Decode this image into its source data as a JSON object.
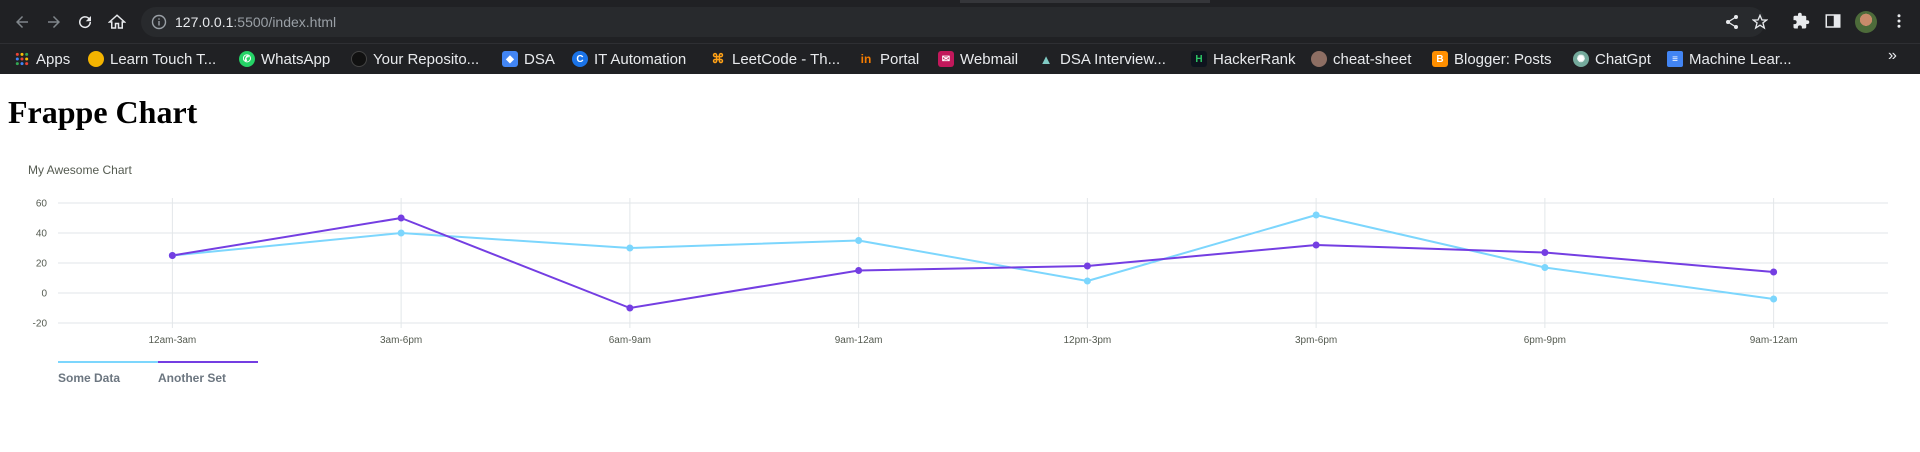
{
  "browser": {
    "url_host": "127.0.0.1",
    "url_rest": ":5500/index.html",
    "bookmarks": [
      {
        "label": "Apps",
        "icon": "apps-grid-icon",
        "color": "#e8eaed"
      },
      {
        "label": "Learn Touch T...",
        "icon": "typing-icon",
        "color": "#f4b400"
      },
      {
        "label": "WhatsApp",
        "icon": "whatsapp-icon",
        "color": "#25d366"
      },
      {
        "label": "Your Reposito...",
        "icon": "github-icon",
        "color": "#111111"
      },
      {
        "label": "DSA",
        "icon": "shield-icon",
        "color": "#4285f4"
      },
      {
        "label": "IT Automation",
        "icon": "coursera-icon",
        "color": "#1a73e8"
      },
      {
        "label": "LeetCode - Th...",
        "icon": "leetcode-icon",
        "color": "#ffa116"
      },
      {
        "label": "Portal",
        "icon": "portal-icon",
        "color": "#f57c00"
      },
      {
        "label": "Webmail",
        "icon": "webmail-icon",
        "color": "#c2185b"
      },
      {
        "label": "DSA Interview...",
        "icon": "mountain-icon",
        "color": "#80cbc4"
      },
      {
        "label": "HackerRank",
        "icon": "hackerrank-icon",
        "color": "#2ec866"
      },
      {
        "label": "cheat-sheet",
        "icon": "cheat-sheet-icon",
        "color": "#8d6e63"
      },
      {
        "label": "Blogger: Posts",
        "icon": "blogger-icon",
        "color": "#ff8f00"
      },
      {
        "label": "ChatGpt",
        "icon": "chatgpt-icon",
        "color": "#74aa9c"
      },
      {
        "label": "Machine Lear...",
        "icon": "docs-icon",
        "color": "#4285f4"
      }
    ]
  },
  "page": {
    "heading": "Frappe Chart"
  },
  "chart_data": {
    "type": "line",
    "title": "My Awesome Chart",
    "categories": [
      "12am-3am",
      "3am-6pm",
      "6am-9am",
      "9am-12am",
      "12pm-3pm",
      "3pm-6pm",
      "6pm-9pm",
      "9am-12am"
    ],
    "yticks": [
      60,
      40,
      20,
      0,
      -20
    ],
    "ylim": [
      -20,
      60
    ],
    "grid": true,
    "legend_position": "bottom-left",
    "series": [
      {
        "name": "Some Data",
        "color": "#7cd6fd",
        "values": [
          25,
          40,
          30,
          35,
          8,
          52,
          17,
          -4
        ]
      },
      {
        "name": "Another Set",
        "color": "#743ee2",
        "values": [
          25,
          50,
          -10,
          15,
          18,
          32,
          27,
          14
        ]
      }
    ]
  }
}
